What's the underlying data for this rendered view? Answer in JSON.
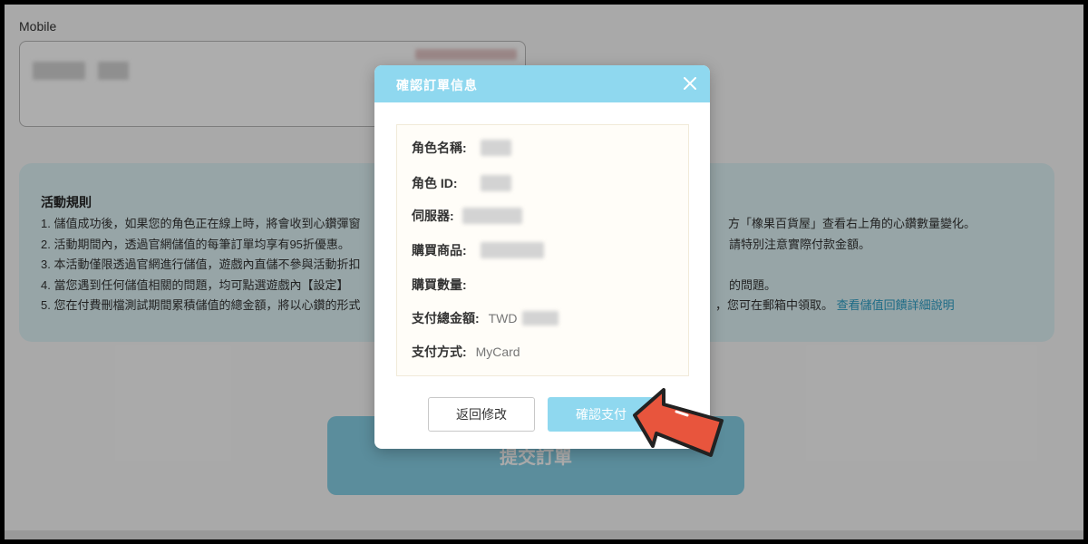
{
  "form": {
    "mobile_label": "Mobile"
  },
  "rules": {
    "title": "活動規則",
    "items": [
      {
        "left": "1. 儲值成功後，如果您的角色正在線上時，將會收到心鑽彈窗",
        "right": "方「橡果百貨屋」查看右上角的心鑽數量變化。"
      },
      {
        "left": "2. 活動期間內，透過官網儲值的每筆訂單均享有95折優惠。",
        "right": "請特別注意實際付款金額。"
      },
      {
        "left": "3. 本活動僅限透過官網進行儲值，遊戲內直儲不參與活動折扣",
        "right": ""
      },
      {
        "left": "4. 當您遇到任何儲值相關的問題，均可點選遊戲內【設定】",
        "right": "的問題。"
      },
      {
        "left": "5. 您在付費刪檔測試期間累積儲值的總金額，將以心鑽的形式",
        "right": "，您可在郵箱中領取。"
      }
    ],
    "link": "查看儲值回饋詳細說明"
  },
  "submit_label": "提交訂單",
  "modal": {
    "title": "確認訂單信息",
    "fields": [
      {
        "label": "角色名稱:",
        "value": ""
      },
      {
        "label": "角色 ID:",
        "value": ""
      },
      {
        "label": "伺服器:",
        "value": ""
      },
      {
        "label": "購買商品:",
        "value": ""
      },
      {
        "label": "購買數量:",
        "value": ""
      },
      {
        "label": "支付總金額:",
        "value": "TWD"
      },
      {
        "label": "支付方式:",
        "value": "MyCard"
      }
    ],
    "back_label": "返回修改",
    "confirm_label": "確認支付"
  },
  "icons": {
    "close": "close-icon",
    "pointer": "arrow-pointer-icon"
  },
  "colors": {
    "accent": "#8fd8ef",
    "submit": "#86d0e6",
    "rules_bg": "#dff3f6",
    "link": "#2a9ec6",
    "arrow": "#e8553d"
  }
}
